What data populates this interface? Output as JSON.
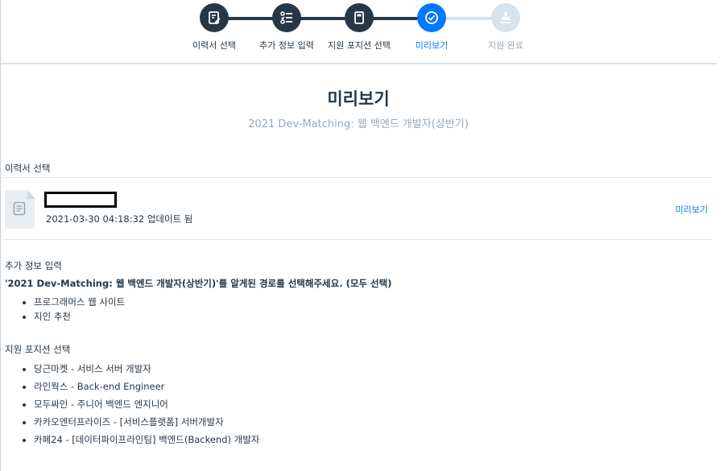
{
  "stepper": {
    "steps": [
      {
        "label": "이력서 선택",
        "icon": "document-edit-icon",
        "state": "completed"
      },
      {
        "label": "추가 정보 입력",
        "icon": "checklist-icon",
        "state": "completed"
      },
      {
        "label": "지원 포지션 선택",
        "icon": "book-icon",
        "state": "completed"
      },
      {
        "label": "미리보기",
        "icon": "check-circle-icon",
        "state": "active"
      },
      {
        "label": "지원 완료",
        "icon": "stamp-icon",
        "state": "pending"
      }
    ],
    "colors": {
      "completed": "#263747",
      "active": "#0078ff",
      "pending": "#d7e2eb",
      "pending_label": "#98a8b9"
    }
  },
  "header": {
    "title": "미리보기",
    "subtitle": "2021 Dev-Matching: 웹 백엔드 개발자(상반기)"
  },
  "resume_section": {
    "heading": "이력서 선택",
    "updated_at": "2021-03-30 04:18:32 업데이트 됨",
    "preview_link": "미리보기"
  },
  "extra_info_section": {
    "heading": "추가 정보 입력",
    "question": "'2021 Dev-Matching: 웹 백엔드 개발자(상반기)'를 알게된 경로를 선택해주세요. (모두 선택)",
    "answers": [
      "프로그래머스 웹 사이트",
      "지인 추천"
    ]
  },
  "positions_section": {
    "heading": "지원 포지션 선택",
    "positions": [
      "당근마켓 - 서비스 서버 개발자",
      "라인웍스 - Back-end Engineer",
      "모두싸인 - 주니어 백엔드 엔지니어",
      "카카오엔터프라이즈 - [서비스플랫폼] 서버개발자",
      "카페24 - [데이터파이프라인팀] 백엔드(Backend) 개발자"
    ]
  }
}
